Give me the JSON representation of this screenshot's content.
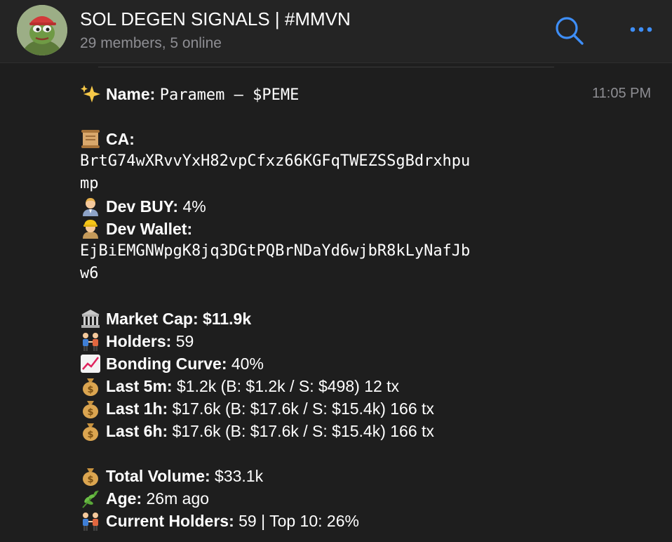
{
  "header": {
    "title": "SOL DEGEN SIGNALS | #MMVN",
    "subtitle": "29 members, 5 online",
    "avatar_icon": "pepe-frog-avatar",
    "search_icon": "search-icon",
    "more_icon": "more-dots-icon",
    "accent_color": "#3e8ef7"
  },
  "message": {
    "time": "11:05 PM",
    "name_label": "Name:",
    "name_value": "Paramem – $PEME",
    "ca_label": "CA:",
    "ca_line1": "BrtG74wXRvvYxH82vpCfxz66KGFqTWEZSSgBdrxhpu",
    "ca_line2": "mp",
    "dev_buy_label": "Dev BUY:",
    "dev_buy_value": "4%",
    "dev_wallet_label": "Dev Wallet:",
    "dev_wallet_line1": "EjBiEMGNWpgK8jq3DGtPQBrNDaYd6wjbR8kLyNafJb",
    "dev_wallet_line2": "w6",
    "market_cap_label": "Market Cap:",
    "market_cap_value": "$11.9k",
    "holders_label": "Holders:",
    "holders_value": "59",
    "bonding_label": "Bonding Curve:",
    "bonding_value": "40%",
    "last5m_label": "Last 5m:",
    "last5m_value": "$1.2k (B: $1.2k / S: $498) 12 tx",
    "last1h_label": "Last 1h:",
    "last1h_value": "$17.6k (B: $17.6k / S: $15.4k) 166 tx",
    "last6h_label": "Last 6h:",
    "last6h_value": "$17.6k (B: $17.6k / S: $15.4k) 166 tx",
    "total_volume_label": "Total Volume:",
    "total_volume_value": "$33.1k",
    "age_label": "Age:",
    "age_value": "26m ago",
    "current_holders_label": "Current Holders:",
    "current_holders_value": "59 | Top 10: 26%",
    "emoji_icons": [
      "sparkles-icon",
      "scroll-icon",
      "man-office-worker-icon",
      "construction-worker-icon",
      "bank-icon",
      "people-holding-hands-icon",
      "chart-increasing-icon",
      "money-bag-icon",
      "herb-icon"
    ]
  }
}
